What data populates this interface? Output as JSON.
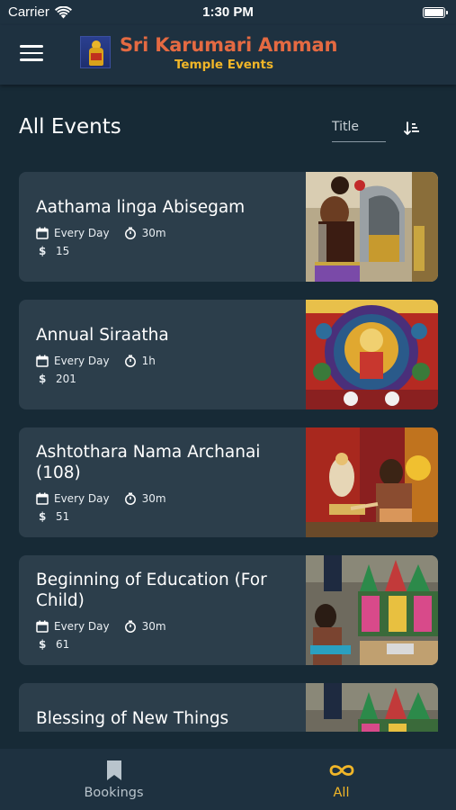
{
  "status_bar": {
    "carrier": "Carrier",
    "time": "1:30 PM"
  },
  "header": {
    "title": "Sri Karumari Amman",
    "subtitle": "Temple Events"
  },
  "page": {
    "title": "All Events",
    "sort_placeholder": "Title"
  },
  "events": [
    {
      "title": "Aathama linga Abisegam",
      "frequency": "Every Day",
      "duration": "30m",
      "price": "15"
    },
    {
      "title": "Annual Siraatha",
      "frequency": "Every Day",
      "duration": "1h",
      "price": "201"
    },
    {
      "title": "Ashtothara Nama Archanai (108)",
      "frequency": "Every Day",
      "duration": "30m",
      "price": "51"
    },
    {
      "title": "Beginning of Education (For Child)",
      "frequency": "Every Day",
      "duration": "30m",
      "price": "61"
    },
    {
      "title": "Blessing of New Things"
    }
  ],
  "bottom_nav": {
    "bookings_label": "Bookings",
    "all_label": "All",
    "active": "All"
  },
  "colors": {
    "background": "#172a36",
    "card": "#2c3e4b",
    "title_orange": "#e46a42",
    "subtitle_gold": "#f1b628",
    "active_tab": "#f1b628",
    "inactive_tab": "#b9c4cc"
  }
}
